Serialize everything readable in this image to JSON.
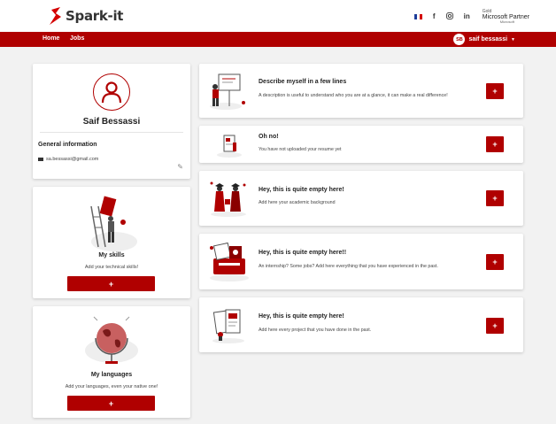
{
  "colors": {
    "brand": "#b00000",
    "background": "#f2f2f2",
    "card": "#ffffff"
  },
  "header": {
    "logo_text": "Spark-it",
    "icons": [
      "french-flag-icon",
      "facebook-icon",
      "instagram-icon",
      "linkedin-icon"
    ],
    "partner": {
      "top": "Gold",
      "main": "Microsoft Partner",
      "sub": "Microsoft"
    }
  },
  "nav": {
    "links": [
      "Home",
      "Jobs"
    ],
    "user_initials": "SB",
    "user_name": "saif bessassi"
  },
  "profile": {
    "name": "Saif Bessassi",
    "general_title": "General information",
    "email": "sa.bessassi@gmail.com"
  },
  "skills": {
    "title": "My skills",
    "desc": "Add your technical skills!",
    "button": "+"
  },
  "languages": {
    "title": "My languages",
    "desc": "Add your languages, even your native one!",
    "button": "+"
  },
  "sections": [
    {
      "title": "Describe myself in a few lines",
      "desc": "A description is useful to understand who you are at a glance, it can make a real difference!",
      "button": "+"
    },
    {
      "title": "Oh no!",
      "desc": "You have not uploaded your resume yet",
      "button": "+"
    },
    {
      "title": "Hey, this is quite empty here!",
      "desc": "Add here your academic background",
      "button": "+"
    },
    {
      "title": "Hey, this is quite empty here!!",
      "desc": "An internship? Some jobs? Add here everything that you have experienced in the past.",
      "button": "+"
    },
    {
      "title": "Hey, this is quite empty here!",
      "desc": "Add here every project that you have done in the past.",
      "button": "+"
    }
  ]
}
